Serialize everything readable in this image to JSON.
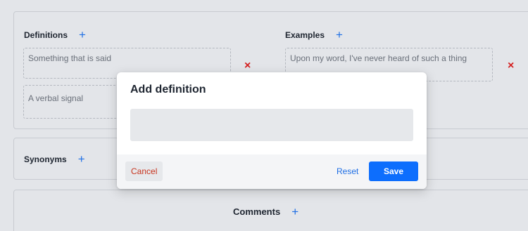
{
  "definitions": {
    "title": "Definitions",
    "add_icon": "+",
    "items": [
      {
        "text": "Something that is said"
      },
      {
        "text": "A verbal signal"
      }
    ],
    "remove_icon": "×"
  },
  "examples": {
    "title": "Examples",
    "add_icon": "+",
    "items": [
      {
        "text": "Upon my word, I've never heard of such a thing"
      }
    ],
    "remove_icon": "×"
  },
  "synonyms": {
    "title": "Synonyms",
    "add_icon": "+"
  },
  "comments": {
    "title": "Comments",
    "add_icon": "+"
  },
  "modal": {
    "title": "Add definition",
    "input_value": "",
    "input_placeholder": "",
    "cancel_label": "Cancel",
    "reset_label": "Reset",
    "save_label": "Save"
  },
  "colors": {
    "accent": "#0d6efd",
    "danger": "#d41e1e",
    "background": "#e3e5e9"
  }
}
